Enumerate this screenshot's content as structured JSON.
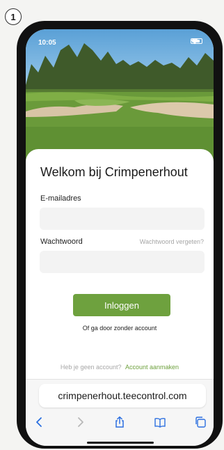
{
  "step": "1",
  "status_bar": {
    "time": "10:05"
  },
  "login": {
    "title": "Welkom bij Crimpenerhout",
    "email_label": "E-mailadres",
    "email_value": "",
    "password_label": "Wachtwoord",
    "password_value": "",
    "forgot_link": "Wachtwoord vergeten?",
    "login_button": "Inloggen",
    "guest_link": "Of ga door zonder account",
    "no_account_text": "Heb je geen account?",
    "create_account_link": "Account aanmaken"
  },
  "browser": {
    "url": "crimpenerhout.teecontrol.com",
    "toolbar_icons": [
      "back-icon",
      "forward-icon",
      "share-icon",
      "bookmarks-icon",
      "tabs-icon"
    ]
  },
  "colors": {
    "accent": "#6ea13e",
    "muted_text": "#a6a6a6",
    "field_bg": "#f3f3f3"
  }
}
